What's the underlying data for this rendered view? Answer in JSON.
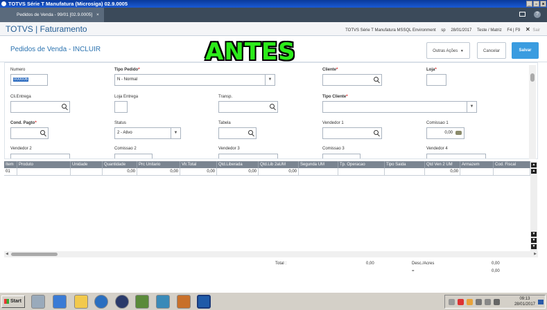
{
  "window": {
    "title": "TOTVS Série T Manufatura (Microsiga) 02.9.0005",
    "controls": [
      "_",
      "ё",
      "X"
    ]
  },
  "tabbar": {
    "tab_label": "Pedidos de Venda - 99/01 [02.9.0005]",
    "tab_close": "×"
  },
  "header": {
    "app_title": "TOTVS | Faturamento",
    "environment": "TOTVS Série T Manufatura MSSQL Environment",
    "user": "sp",
    "date": "28/01/2017",
    "company": "Teste / Matriz",
    "shortcut": "F4 | F9",
    "exit_label": "Sair"
  },
  "page": {
    "title": "Pedidos de Venda - INCLUIR",
    "overlay_text": "ANTES",
    "buttons": {
      "other_actions": "Outras Ações",
      "cancel": "Cancelar",
      "save": "Salvar"
    }
  },
  "form": {
    "numero": {
      "label": "Numero",
      "value": "000006"
    },
    "tipo_pedido": {
      "label": "Tipo Pedido",
      "value": "N - Normal"
    },
    "cliente": {
      "label": "Cliente",
      "value": ""
    },
    "loja": {
      "label": "Loja",
      "value": ""
    },
    "cli_entrega": {
      "label": "Cli.Entrega",
      "value": ""
    },
    "loja_entrega": {
      "label": "Loja Entrega",
      "value": ""
    },
    "transp": {
      "label": "Transp.",
      "value": ""
    },
    "tipo_cliente": {
      "label": "Tipo Cliente",
      "value": ""
    },
    "cond_pagto": {
      "label": "Cond. Pagto",
      "value": ""
    },
    "status": {
      "label": "Status",
      "value": "2 - Ativo"
    },
    "tabela": {
      "label": "Tabela",
      "value": ""
    },
    "vendedor1": {
      "label": "Vendedor 1",
      "value": ""
    },
    "comissao1": {
      "label": "Comissao 1",
      "value": "0,00"
    },
    "vendedor2": {
      "label": "Vendedor 2"
    },
    "comissao2": {
      "label": "Comissao 2"
    },
    "vendedor3": {
      "label": "Vendedor 3"
    },
    "comissao3": {
      "label": "Comissao 3"
    },
    "vendedor4": {
      "label": "Vendedor 4"
    },
    "required_mark": "*"
  },
  "grid": {
    "columns": [
      "Item",
      "Produto",
      "Unidade",
      "Quantidade",
      "Prc Unitario",
      "Vlr.Total",
      "Qtd.Liberada",
      "Qtd.Lib 2aUM",
      "Segunda UM",
      "Tp. Operacao",
      "Tipo Saida",
      "Qtd Ven 2 UM",
      "Armazem",
      "Cod. Fiscal"
    ],
    "row": [
      "01",
      "",
      "",
      "0,00",
      "0,00",
      "0,00",
      "0,00",
      "0,00",
      "",
      "",
      "",
      "0,00",
      "",
      ""
    ]
  },
  "totals": {
    "total_label": "Total :",
    "total_value": "0,00",
    "desc_label": "Desc./Acres",
    "desc_value": "0,00",
    "eq_label": "=",
    "eq_value": "0,00"
  },
  "taskbar": {
    "start_label": "Start",
    "time": "09:13",
    "date": "28/01/2017"
  }
}
